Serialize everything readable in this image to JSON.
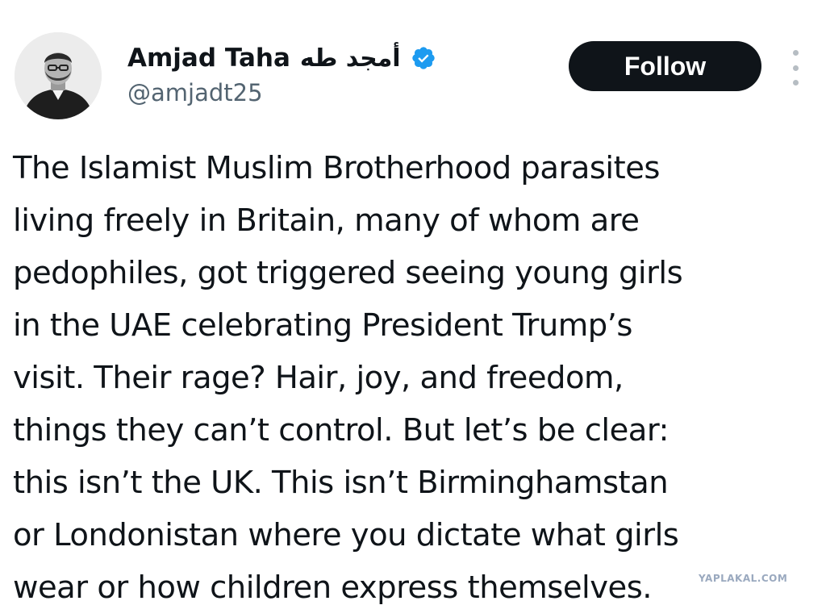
{
  "user": {
    "display_name": "Amjad Taha",
    "arabic_name": "أمجد طه",
    "handle": "@amjadt25",
    "verified": true,
    "verified_color": "#1d9bf0"
  },
  "actions": {
    "follow_label": "Follow",
    "more_icon": "more-vertical-icon"
  },
  "tweet": {
    "lines": [
      "The Islamist Muslim Brotherhood parasites",
      "living freely in Britain, many of whom are",
      "pedophiles, got triggered seeing young girls",
      "in the UAE celebrating President Trump’s",
      "visit. Their rage? Hair, joy, and freedom,",
      "things they can’t control. But let’s be clear:",
      "this isn’t the UK. This isn’t Birminghamstan",
      "or Londonistan where you dictate what girls",
      "wear or how children express themselves."
    ]
  },
  "watermark": "YAPLAKAL.COM",
  "colors": {
    "text": "#0f1419",
    "secondary_text": "#536471",
    "button_bg": "#0f1419",
    "button_text": "#ffffff"
  }
}
